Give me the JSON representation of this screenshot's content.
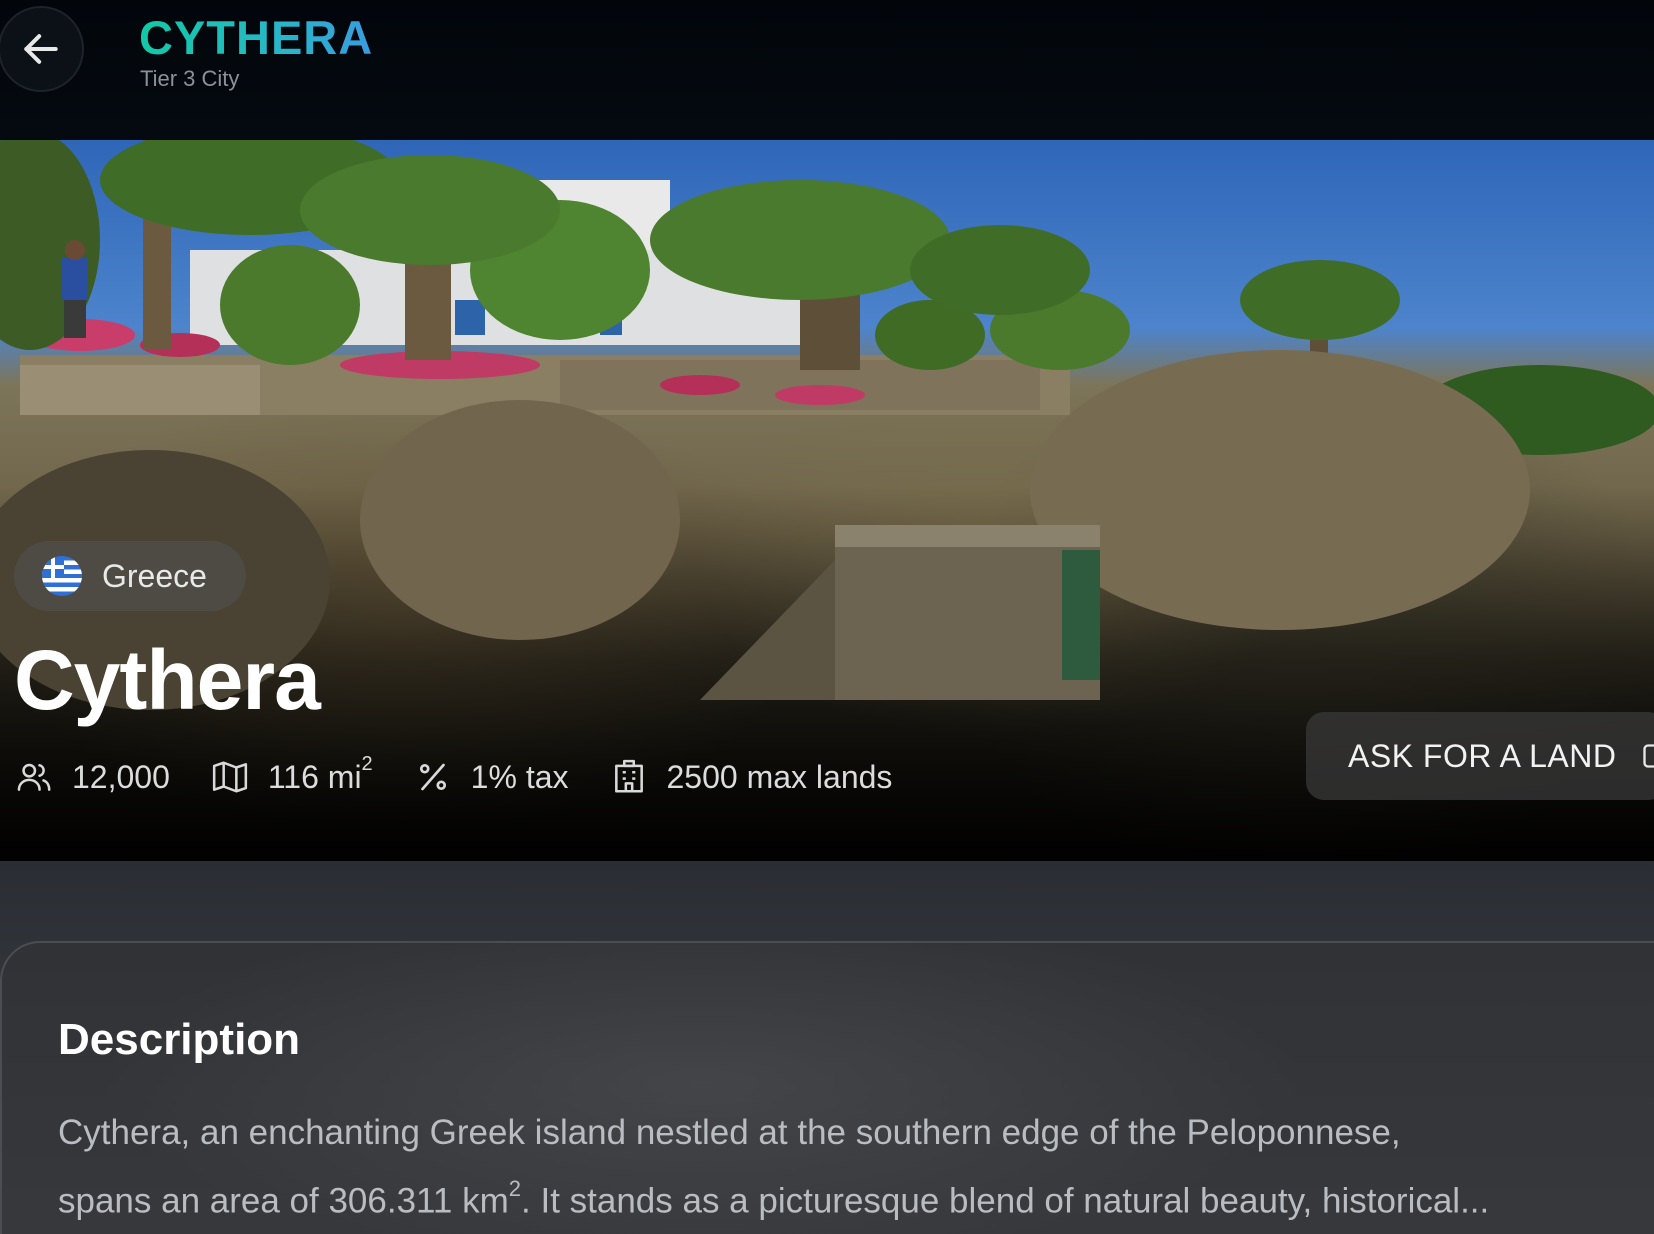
{
  "header": {
    "back_icon": "arrow-left-icon",
    "city_name": "CYTHERA",
    "tier": "Tier 3 City"
  },
  "hero": {
    "country": "Greece",
    "country_flag": "greece-flag-icon",
    "title": "Cythera",
    "stats": {
      "population": "12,000",
      "population_icon": "users-icon",
      "area": "116 mi",
      "area_unit_exp": "2",
      "area_icon": "map-icon",
      "tax": "1% tax",
      "tax_icon": "percent-icon",
      "max_lands": "2500 max lands",
      "max_lands_icon": "building-icon"
    },
    "ask_button": "ASK FOR A LAND",
    "ask_icon": "external-icon"
  },
  "description": {
    "heading": "Description",
    "line1": "Cythera, an enchanting Greek island nestled at the southern edge of the Peloponnese,",
    "line2_start": "spans an area of 306.311 km",
    "line2_exp": "2",
    "line2_end": ". It stands as a picturesque blend of natural beauty, historical..."
  },
  "colors": {
    "accent_start": "#12c9a5",
    "accent_end": "#3a9be0",
    "background": "#0b0d12",
    "card": "#303236"
  }
}
